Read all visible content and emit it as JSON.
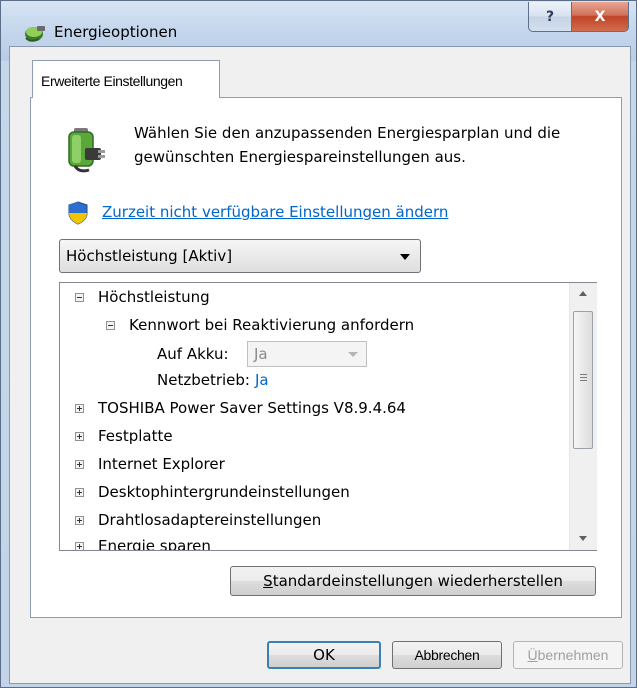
{
  "window": {
    "title": "Energieoptionen",
    "help_glyph": "?",
    "close_glyph": "X"
  },
  "tab": {
    "label": "Erweiterte Einstellungen"
  },
  "description": "Wählen Sie den anzupassenden Energiesparplan und die gewünschten Energiespareinstellungen aus.",
  "change_link": "Zurzeit nicht verfügbare Einstellungen ändern",
  "plan_select": {
    "value": "Höchstleistung [Aktiv]"
  },
  "tree": {
    "plan_node": "Höchstleistung",
    "password_node": "Kennwort bei Reaktivierung anfordern",
    "on_battery_label": "Auf Akku:",
    "on_battery_value": "Ja",
    "plugged_in_label": "Netzbetrieb:",
    "plugged_in_value": "Ja",
    "collapsed_nodes": [
      "TOSHIBA Power Saver Settings V8.9.4.64",
      "Festplatte",
      "Internet Explorer",
      "Desktophintergrundeinstellungen",
      "Drahtlosadaptereinstellungen",
      "Energie sparen"
    ]
  },
  "buttons": {
    "restore_prefix": "S",
    "restore_rest": "tandardeinstellungen wiederherstellen",
    "ok": "OK",
    "cancel": "Abbrechen",
    "apply_prefix": "Ü",
    "apply_rest": "bernehmen"
  },
  "icons": {
    "title": "power-options-icon",
    "battery": "battery-plug-icon",
    "shield": "uac-shield-icon"
  },
  "colors": {
    "link": "#0066cc",
    "close_button": "#c14427",
    "default_button_border": "#3c7fb1"
  }
}
